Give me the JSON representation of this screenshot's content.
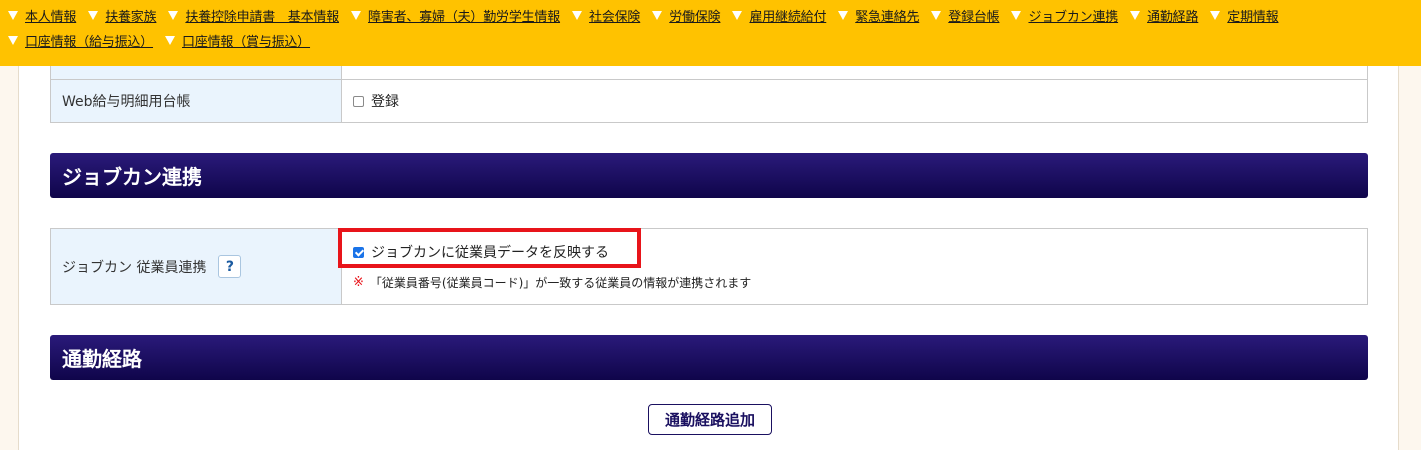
{
  "nav": {
    "row1": [
      "本人情報",
      "扶養家族",
      "扶養控除申請書　基本情報",
      "障害者、寡婦（夫）勤労学生情報",
      "社会保険",
      "労働保険",
      "雇用継続給付",
      "緊急連絡先",
      "登録台帳",
      "ジョブカン連携",
      "通勤経路",
      "定期情報"
    ],
    "row2": [
      "口座情報（給与振込）",
      "口座情報（賞与振込）"
    ]
  },
  "web_payslip": {
    "label": "Web給与明細用台帳",
    "checkbox_label": "登録",
    "checked": false
  },
  "jobcan_section": {
    "title": "ジョブカン連携",
    "row_label": "ジョブカン 従業員連携",
    "help_label": "?",
    "checkbox_label": "ジョブカンに従業員データを反映する",
    "checked": true,
    "note_mark": "※",
    "note": "「従業員番号(従業員コード)」が一致する従業員の情報が連携されます"
  },
  "commute_section": {
    "title": "通勤経路",
    "add_button": "通勤経路追加"
  },
  "colors": {
    "nav_bg": "#ffc200",
    "section_header": "#1a0f63",
    "label_bg": "#eaf4fd",
    "highlight": "#e8141a",
    "checkbox_checked": "#1a73e8"
  }
}
